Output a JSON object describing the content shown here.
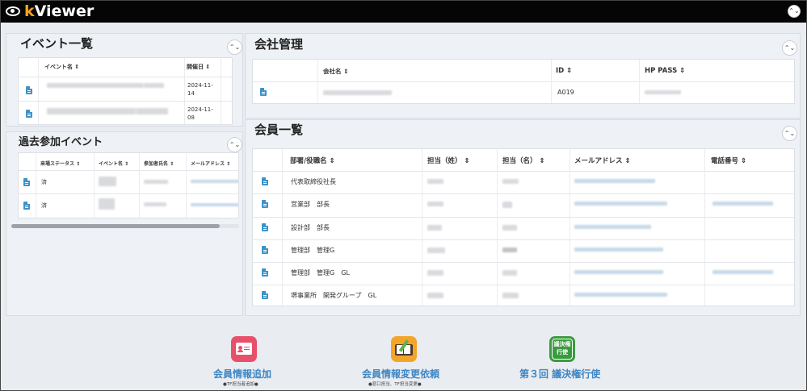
{
  "app": {
    "logo_k": "k",
    "logo_rest": "Viewer"
  },
  "events": {
    "title": "イベント一覧",
    "col_name": "イベント名 ⇕",
    "col_date": "開催日 ⇕",
    "rows": [
      {
        "date": "2024-11-\n14"
      },
      {
        "date": "2024-11-\n08"
      }
    ]
  },
  "past_events": {
    "title": "過去参加イベント",
    "col_status": "来場ステータス ⇕",
    "col_event": "イベント名 ⇕",
    "col_name": "参加者氏名 ⇕",
    "col_email": "メールアドレス ⇕",
    "rows": [
      {
        "status": "済"
      },
      {
        "status": "済"
      }
    ]
  },
  "company": {
    "title": "会社管理",
    "col_name": "会社名 ⇕",
    "col_id": "ID ⇕",
    "col_pass": "HP PASS ⇕",
    "rows": [
      {
        "id": "A019"
      }
    ]
  },
  "members": {
    "title": "会員一覧",
    "col_dept": "部署/役職名 ⇕",
    "col_last": "担当（姓） ⇕",
    "col_first": "担当（名） ⇕",
    "col_email": "メールアドレス ⇕",
    "col_phone": "電話番号 ⇕",
    "rows": [
      {
        "dept": "代表取締役社長"
      },
      {
        "dept": "営業部　部長"
      },
      {
        "dept": "設計部　部長"
      },
      {
        "dept": "管理部　管理G"
      },
      {
        "dept": "管理部　管理G　GL"
      },
      {
        "dept": "堺事業所　開発グループ　GL"
      }
    ]
  },
  "actions": [
    {
      "label": "会員情報追加",
      "sub": "●TF担当者追加●",
      "icon": "member-card-icon",
      "color": "#e8506a"
    },
    {
      "label": "会員情報変更依頼",
      "sub": "●窓口担当、TF担当変更●",
      "icon": "edit-book-icon",
      "color": "#f3a52a"
    },
    {
      "label": "第３回 議決権行使",
      "sub": "",
      "icon_text": "議決権\n行使",
      "icon": "vote-icon",
      "color": "#3a9b3e"
    }
  ],
  "colors": {
    "accent": "#3e86c3",
    "doc_icon": "#3d93c9",
    "brand_k": "#f4a21e"
  }
}
